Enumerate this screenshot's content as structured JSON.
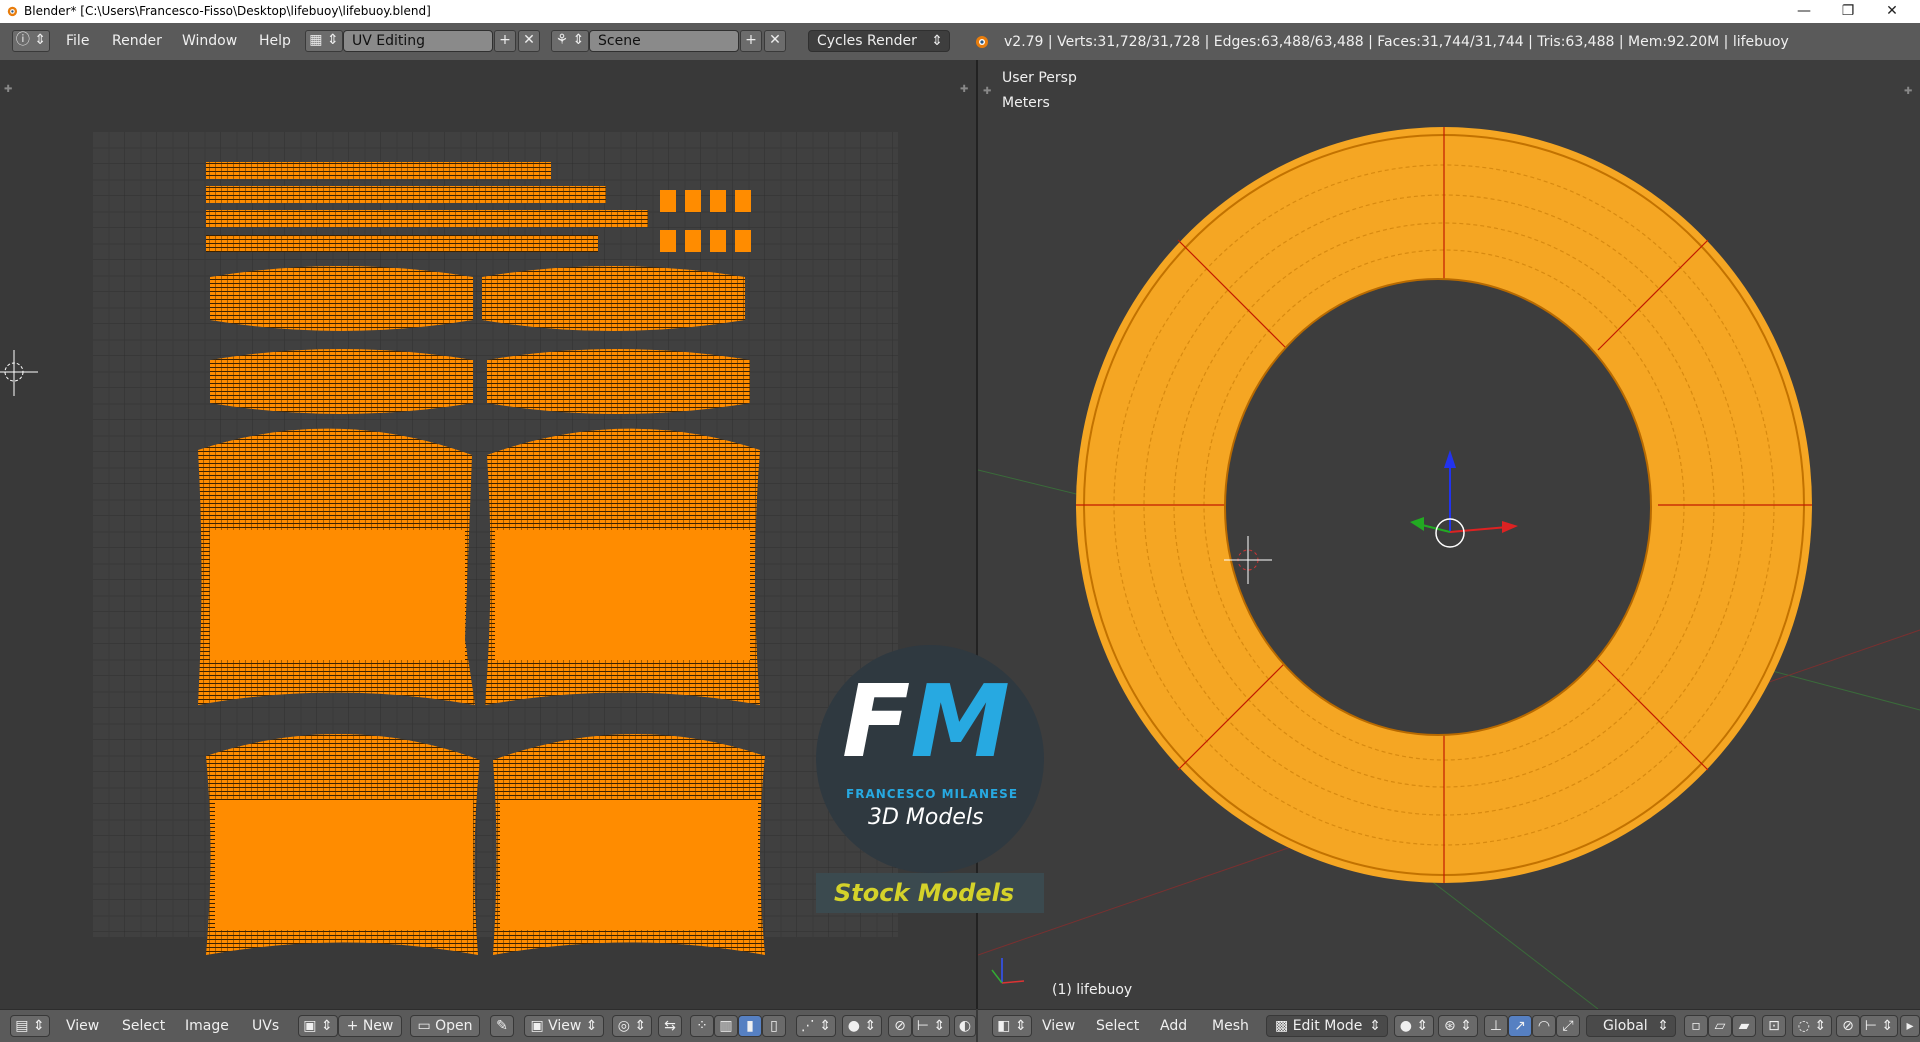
{
  "window": {
    "title": "Blender* [C:\\Users\\Francesco-Fisso\\Desktop\\lifebuoy\\lifebuoy.blend]",
    "minimize": "—",
    "restore": "❐",
    "close": "✕"
  },
  "info_header": {
    "menus": [
      "File",
      "Render",
      "Window",
      "Help"
    ],
    "screen_layout": "UV Editing",
    "scene": "Scene",
    "render_engine": "Cycles Render",
    "stats": "v2.79 | Verts:31,728/31,728 | Edges:63,488/63,488 | Faces:31,744/31,744 | Tris:63,488 | Mem:92.20M | lifebuoy"
  },
  "uv_header": {
    "menus": [
      "View",
      "Select",
      "Image",
      "UVs"
    ],
    "new_label": "New",
    "open_label": "Open",
    "view_label": "View"
  },
  "viewport": {
    "perspective_label": "User Persp",
    "units_label": "Meters",
    "object_label": "(1) lifebuoy"
  },
  "viewport_header": {
    "menus": [
      "View",
      "Select",
      "Add",
      "Mesh"
    ],
    "mode": "Edit Mode",
    "orientation": "Global"
  },
  "watermark": {
    "monogram_f": "F",
    "monogram_m": "M",
    "brand": "FRANCESCO MILANESE",
    "tagline": "3D Models",
    "banner": "Stock Models"
  },
  "colors": {
    "uv_orange": "#ff8c00",
    "mesh_orange": "#f5a623",
    "brand_blue": "#27a9e1",
    "banner_yellow": "#d4d22a"
  },
  "icons": [
    "info-icon",
    "screen-layout-icon",
    "scene-icon",
    "blender-logo-icon",
    "editor-type-icon",
    "image-icon",
    "pin-icon",
    "uv-sync-icon",
    "pivot-icon",
    "proportional-icon",
    "snap-icon",
    "viewport-shading-icon",
    "manipulator-icon",
    "vertex-select-icon",
    "edge-select-icon",
    "face-select-icon"
  ]
}
